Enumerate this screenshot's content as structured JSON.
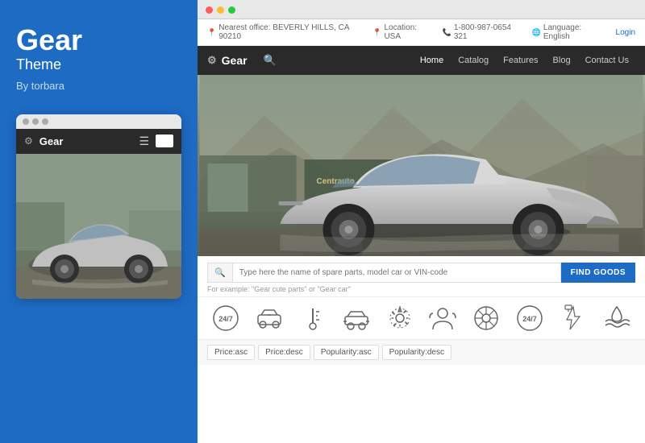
{
  "left": {
    "title": "Gear",
    "subtitle": "Theme",
    "author": "By torbara",
    "mobile_preview": {
      "navbar_title": "Gear"
    }
  },
  "browser": {
    "dots": [
      "red",
      "yellow",
      "green"
    ]
  },
  "info_bar": {
    "office": "Nearest office: BEVERLY HILLS, CA 90210",
    "location": "Location: USA",
    "phone": "1-800-987-0654 321",
    "language": "Language: English",
    "login": "Login"
  },
  "navbar": {
    "brand": "Gear",
    "links": [
      {
        "label": "Home",
        "active": true
      },
      {
        "label": "Catalog",
        "active": false
      },
      {
        "label": "Features",
        "active": false
      },
      {
        "label": "Blog",
        "active": false
      },
      {
        "label": "Contact Us",
        "active": false
      }
    ]
  },
  "search": {
    "placeholder": "Type here the name of spare parts, model car or VIN-code",
    "button": "FIND GOODS",
    "example": "For example: \"Gear cute parts\" or \"Gear car\""
  },
  "icons": [
    "24/7 service",
    "Car parts",
    "Temperature",
    "Car service",
    "Settings",
    "Support",
    "Wheel",
    "24/7",
    "Electric",
    "Water"
  ],
  "filters": [
    {
      "label": "Price:asc",
      "active": false
    },
    {
      "label": "Price:desc",
      "active": false
    },
    {
      "label": "Popularity:asc",
      "active": false
    },
    {
      "label": "Popularity:desc",
      "active": false
    }
  ]
}
